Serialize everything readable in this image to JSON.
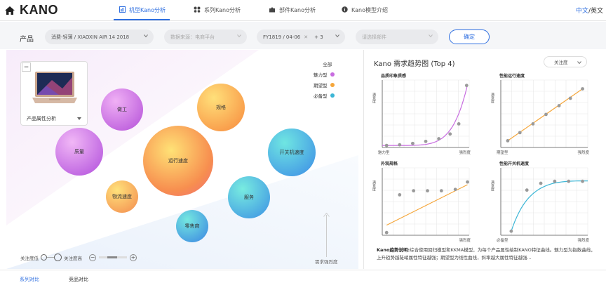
{
  "nav": {
    "brand": "KANO",
    "tabs": [
      {
        "label": "机型Kano分析",
        "icon": "bar-chart-icon",
        "active": true
      },
      {
        "label": "系列Kano分析",
        "icon": "cluster-icon",
        "active": false
      },
      {
        "label": "部件Kano分析",
        "icon": "puzzle-icon",
        "active": false
      },
      {
        "label": "Kano模型介绍",
        "icon": "info-icon",
        "active": false
      }
    ],
    "lang_zh": "中文",
    "lang_sep": "/",
    "lang_en": "英文"
  },
  "filter": {
    "label": "产品",
    "product": "消费-轻薄 / XIAOXIN AIR 14 2018",
    "source_placeholder": "数据来源：电商平台",
    "period": "FY1819 / 04-06",
    "period_extra": "+ 3",
    "component_placeholder": "请选择部件",
    "confirm": "确定"
  },
  "left": {
    "card_label": "产品属性分析",
    "minus": "−",
    "legend": {
      "header": "全部",
      "items": [
        {
          "label": "魅力型",
          "color": "#c86ce0"
        },
        {
          "label": "期望型",
          "color": "#f5a63a"
        },
        {
          "label": "必备型",
          "color": "#3cb6d6"
        }
      ]
    },
    "bubbles": [
      {
        "label": "做工"
      },
      {
        "label": "规格"
      },
      {
        "label": "质量"
      },
      {
        "label": "运行速度"
      },
      {
        "label": "开关机速度"
      },
      {
        "label": "物流速度"
      },
      {
        "label": "服务"
      },
      {
        "label": "零售商"
      }
    ],
    "controls": {
      "low": "关注度低",
      "high": "关注度高"
    },
    "y_axis_label": "需求强烈度"
  },
  "right": {
    "title": "Kano 需求趋势图 (Top 4)",
    "attr_select": "关注度",
    "charts": [
      {
        "title": "品质印象质感",
        "ylabel": "满意度",
        "x_start": "魅力型",
        "x_end": "强烈度",
        "type": "attractive",
        "color": "#c86ce0",
        "points": [
          [
            0.05,
            0.03
          ],
          [
            0.2,
            0.04
          ],
          [
            0.35,
            0.06
          ],
          [
            0.5,
            0.09
          ],
          [
            0.65,
            0.13
          ],
          [
            0.78,
            0.2
          ],
          [
            0.88,
            0.35
          ],
          [
            0.97,
            0.92
          ]
        ]
      },
      {
        "title": "性能运行速度",
        "ylabel": "满意度",
        "x_start": "期望型",
        "x_end": "强烈度",
        "type": "performance",
        "color": "#f5a63a",
        "points": [
          [
            0.08,
            0.1
          ],
          [
            0.22,
            0.22
          ],
          [
            0.37,
            0.35
          ],
          [
            0.52,
            0.49
          ],
          [
            0.67,
            0.62
          ],
          [
            0.8,
            0.73
          ],
          [
            0.94,
            0.87
          ]
        ]
      },
      {
        "title": "外观规格",
        "ylabel": "满意度",
        "x_start": "",
        "x_end": "强烈度",
        "type": "performance",
        "color": "#f5a63a",
        "points": [
          [
            0.05,
            0.04
          ],
          [
            0.2,
            0.6
          ],
          [
            0.36,
            0.66
          ],
          [
            0.52,
            0.66
          ],
          [
            0.68,
            0.66
          ],
          [
            0.84,
            0.68
          ],
          [
            0.98,
            0.79
          ]
        ]
      },
      {
        "title": "性能开关机速度",
        "ylabel": "满意度",
        "x_start": "必备型",
        "x_end": "强烈度",
        "type": "must-be",
        "color": "#3cb6d6",
        "points": [
          [
            0.12,
            0.06
          ],
          [
            0.3,
            0.67
          ],
          [
            0.46,
            0.77
          ],
          [
            0.62,
            0.8
          ],
          [
            0.78,
            0.8
          ],
          [
            0.94,
            0.8
          ]
        ]
      }
    ],
    "note_label": "Kano趋势说明:",
    "note_text": "综合使用回归模型和KKMA模型，为每个产品属性绘制KANO特征曲线。魅力型为指数曲线，上升趋势越陡峭属性特征越强；期望型为线性曲线，斜率越大属性特征越强..."
  },
  "bottom": {
    "tabs": [
      "系列对比",
      "竞品对比"
    ]
  }
}
